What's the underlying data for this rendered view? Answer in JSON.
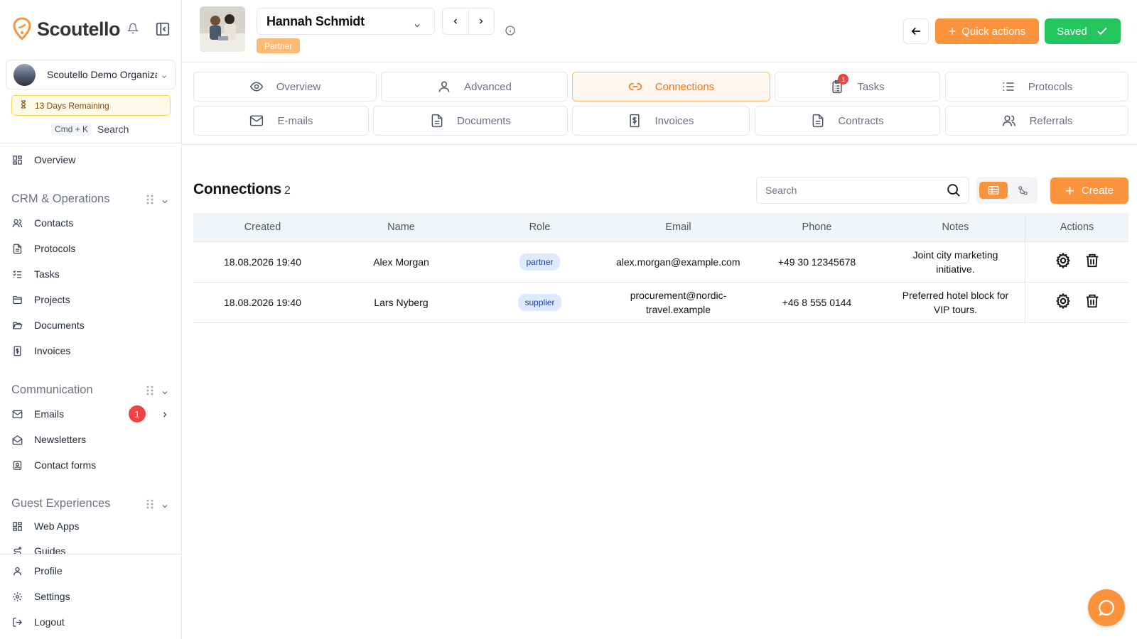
{
  "app": {
    "name": "Scoutello"
  },
  "org": {
    "name": "Scoutello Demo Organization"
  },
  "trial": {
    "text": "13 Days Remaining"
  },
  "search": {
    "shortcut": "Cmd + K",
    "label": "Search"
  },
  "sidebar": {
    "overview": "Overview",
    "sections": [
      {
        "title": "CRM & Operations",
        "items": [
          "Contacts",
          "Protocols",
          "Tasks",
          "Projects",
          "Documents",
          "Invoices"
        ]
      },
      {
        "title": "Communication",
        "items": [
          "Emails",
          "Newsletters",
          "Contact forms"
        ],
        "email_badge": "1"
      },
      {
        "title": "Guest Experiences",
        "items": [
          "Web Apps",
          "Guides"
        ]
      }
    ],
    "footer": [
      "Profile",
      "Settings",
      "Logout"
    ]
  },
  "header": {
    "contact_name": "Hannah Schmidt",
    "contact_type": "Partner",
    "quick_actions": "Quick actions",
    "saved": "Saved"
  },
  "tabs": [
    {
      "label": "Overview"
    },
    {
      "label": "Advanced"
    },
    {
      "label": "Connections",
      "active": true
    },
    {
      "label": "Tasks",
      "badge": "1"
    },
    {
      "label": "Protocols"
    },
    {
      "label": "E-mails"
    },
    {
      "label": "Documents"
    },
    {
      "label": "Invoices"
    },
    {
      "label": "Contracts"
    },
    {
      "label": "Referrals"
    }
  ],
  "connections": {
    "title": "Connections",
    "count": "2",
    "search_placeholder": "Search",
    "create": "Create",
    "columns": [
      "Created",
      "Name",
      "Role",
      "Email",
      "Phone",
      "Notes",
      "Actions"
    ],
    "rows": [
      {
        "created": "18.08.2026 19:40",
        "name": "Alex Morgan",
        "role": "partner",
        "email": "alex.morgan@example.com",
        "phone": "+49 30 12345678",
        "notes": "Joint city marketing initiative."
      },
      {
        "created": "18.08.2026 19:40",
        "name": "Lars Nyberg",
        "role": "supplier",
        "email": "procurement@nordic-travel.example",
        "phone": "+46 8 555 0144",
        "notes": "Preferred hotel block for VIP tours."
      }
    ]
  },
  "colors": {
    "accent": "#fb923c",
    "success": "#22c55e",
    "danger": "#ef4444"
  }
}
